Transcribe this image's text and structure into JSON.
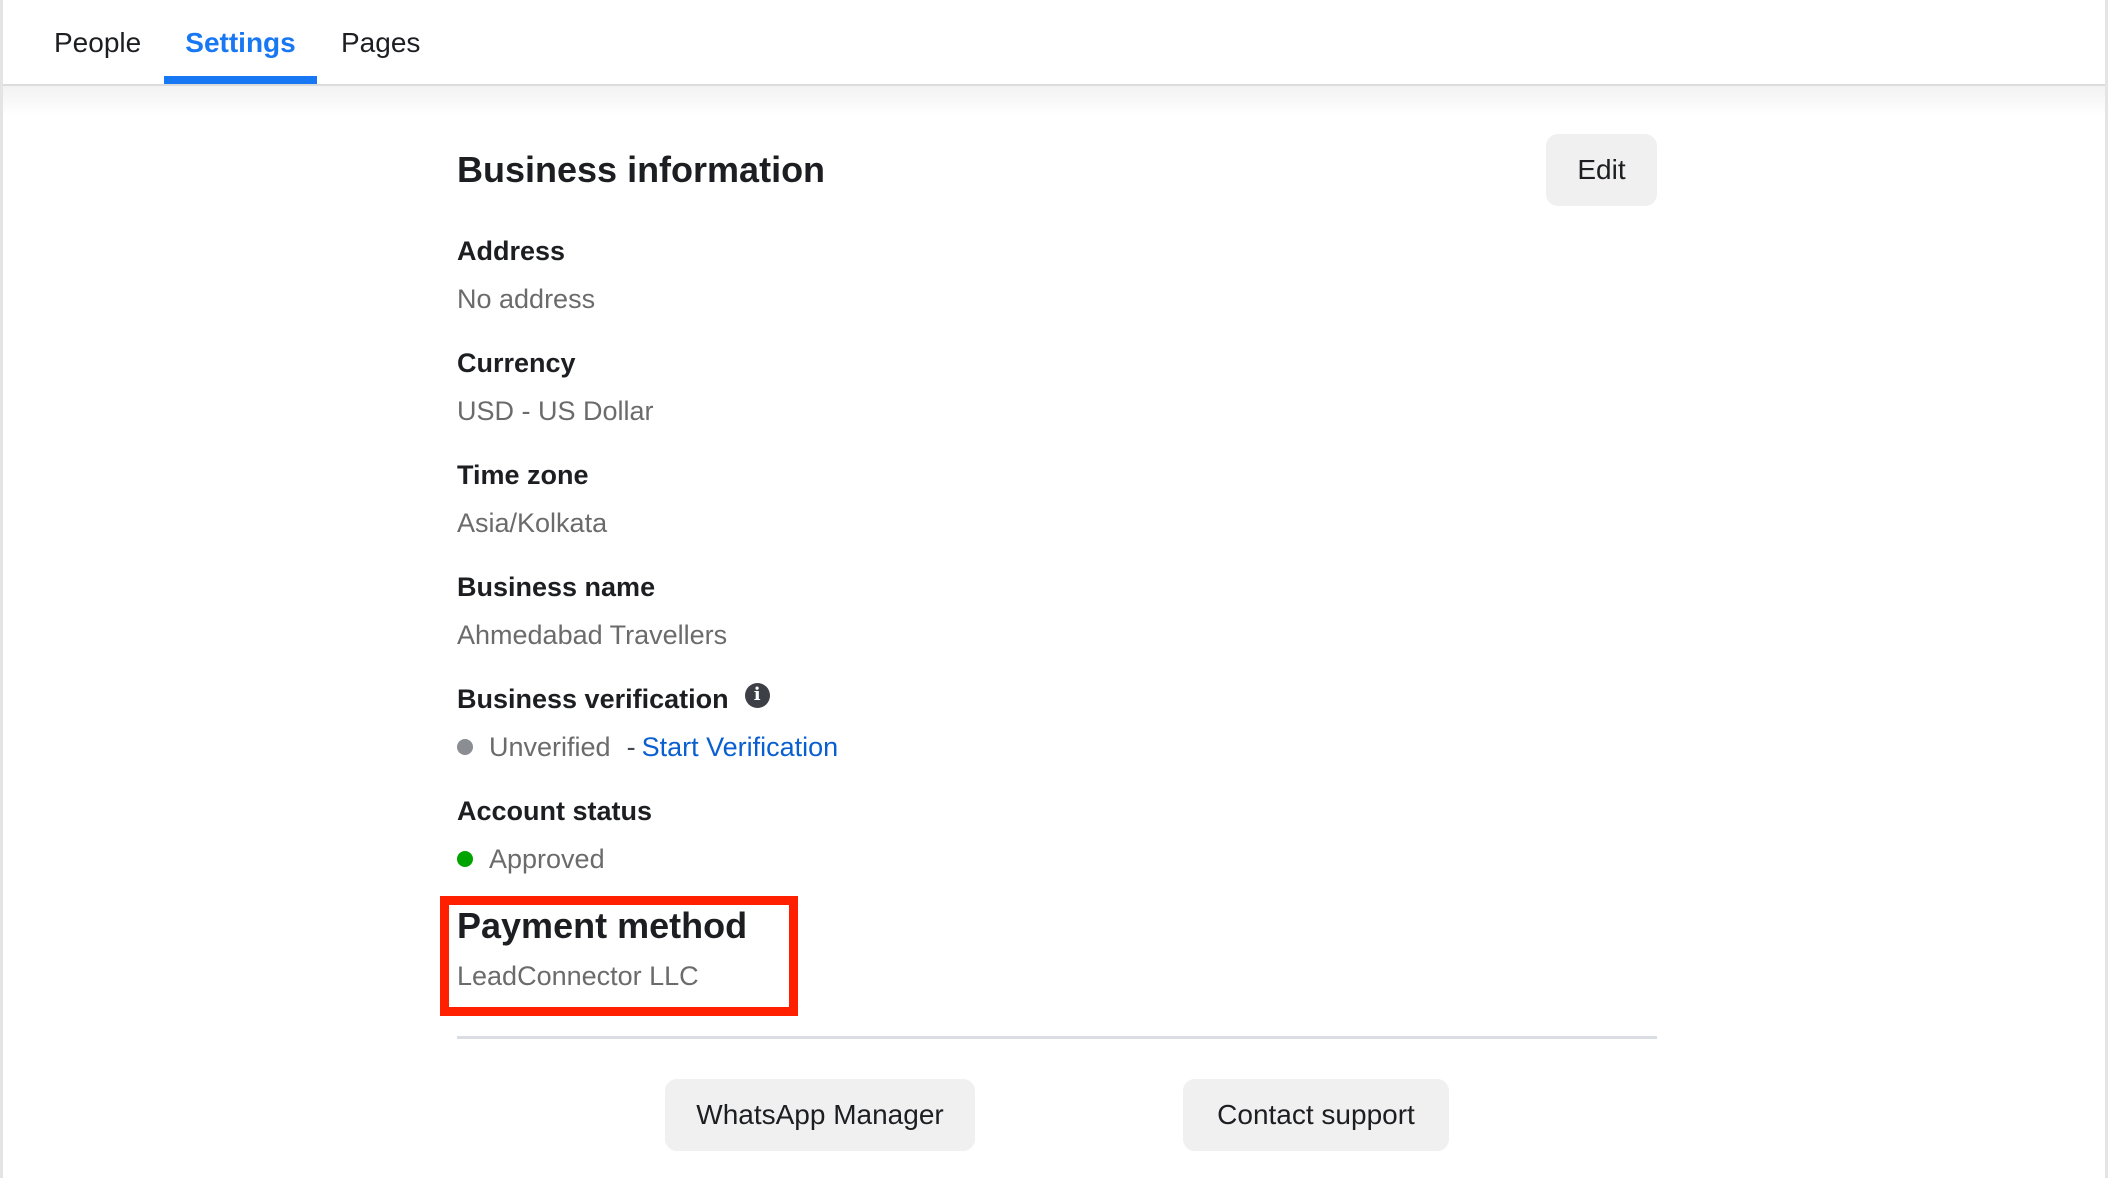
{
  "tabs": [
    {
      "label": "People",
      "active": false
    },
    {
      "label": "Settings",
      "active": true
    },
    {
      "label": "Pages",
      "active": false
    }
  ],
  "colors": {
    "accent": "#1877f2",
    "link": "#0a5fd0",
    "status_unverified": "#8a8d91",
    "status_approved": "#00a400",
    "annotation_box": "#ff2000"
  },
  "section": {
    "title": "Business information",
    "edit_label": "Edit"
  },
  "fields": {
    "address": {
      "label": "Address",
      "value": "No address"
    },
    "currency": {
      "label": "Currency",
      "value": "USD - US Dollar"
    },
    "time_zone": {
      "label": "Time zone",
      "value": "Asia/Kolkata"
    },
    "business_name": {
      "label": "Business name",
      "value": "Ahmedabad Travellers"
    },
    "business_verification": {
      "label": "Business verification",
      "info_icon": "info-icon",
      "status": "Unverified",
      "separator": "-",
      "action_link": "Start Verification"
    },
    "account_status": {
      "label": "Account status",
      "status": "Approved"
    },
    "payment_method": {
      "label": "Payment method",
      "value": "LeadConnector LLC",
      "highlighted": true
    }
  },
  "footer": {
    "whatsapp_manager_label": "WhatsApp Manager",
    "contact_support_label": "Contact support"
  }
}
